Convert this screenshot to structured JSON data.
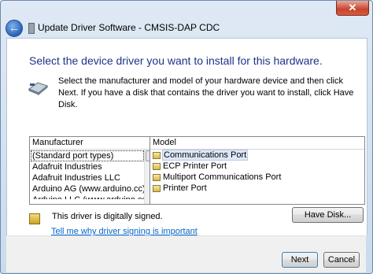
{
  "window": {
    "title": "Update Driver Software - CMSIS-DAP CDC",
    "close_glyph": "✕",
    "back_glyph": "←"
  },
  "main": {
    "heading": "Select the device driver you want to install for this hardware.",
    "description": "Select the manufacturer and model of your hardware device and then click Next. If you have a disk that contains the driver you want to install, click Have Disk."
  },
  "manufacturer_list": {
    "header": "Manufacturer",
    "items": [
      "(Standard port types)",
      "Adafruit Industries",
      "Adafruit Industries LLC",
      "Arduino AG (www.arduino.cc)",
      "Arduino LLC (www.arduino.cc)"
    ]
  },
  "model_list": {
    "header": "Model",
    "items": [
      "Communications Port",
      "ECP Printer Port",
      "Multiport Communications Port",
      "Printer Port"
    ]
  },
  "signing": {
    "status": "This driver is digitally signed.",
    "link": "Tell me why driver signing is important"
  },
  "buttons": {
    "have_disk": "Have Disk...",
    "next": "Next",
    "cancel": "Cancel"
  },
  "colors": {
    "heading": "#1e3287",
    "link": "#0066cc",
    "close_button": "#c7442d"
  },
  "icons": [
    "back-arrow-icon",
    "usb-device-icon",
    "hardware-device-icon",
    "driver-folder-icon",
    "signed-shield-icon"
  ]
}
